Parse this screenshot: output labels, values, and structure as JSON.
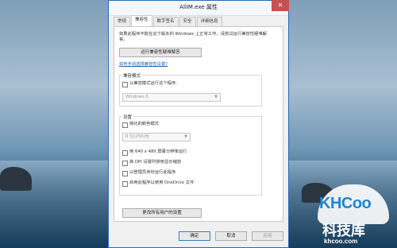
{
  "window": {
    "title": "AliIM.exe 属性",
    "close_glyph": "✕"
  },
  "tabs": [
    {
      "label": "常规"
    },
    {
      "label": "兼容性"
    },
    {
      "label": "数字签名"
    },
    {
      "label": "安全"
    },
    {
      "label": "详细信息"
    }
  ],
  "compat": {
    "intro": "如果此程序不能在这个版本的 Windows 上正常工作，请尝试运行兼容性疑难解答。",
    "troubleshoot_button": "运行兼容性疑难解答",
    "manual_link": "如何手动选择兼容性设置?",
    "mode_group": {
      "title": "兼容模式",
      "checkbox": "以兼容模式运行这个程序:",
      "os_select": "Windows 8"
    },
    "settings_group": {
      "title": "设置",
      "reduced_color": "简化的颜色模式",
      "color_select": "8 位(256)色",
      "run_640": "用 640 x 480 屏幕分辨率运行",
      "disable_dpi": "高 DPI 设置时禁用显示缩放",
      "run_admin": "以管理员身份运行此程序",
      "onedrive": "启用此程序以使用 OneDrive 文件"
    },
    "all_users_button": "更改所有用户的设置"
  },
  "footer": {
    "ok": "确定",
    "cancel": "取消",
    "apply": "应用"
  },
  "watermark": {
    "brand": "KHCoo",
    "name": "科技库",
    "site": "khcoo.com"
  }
}
